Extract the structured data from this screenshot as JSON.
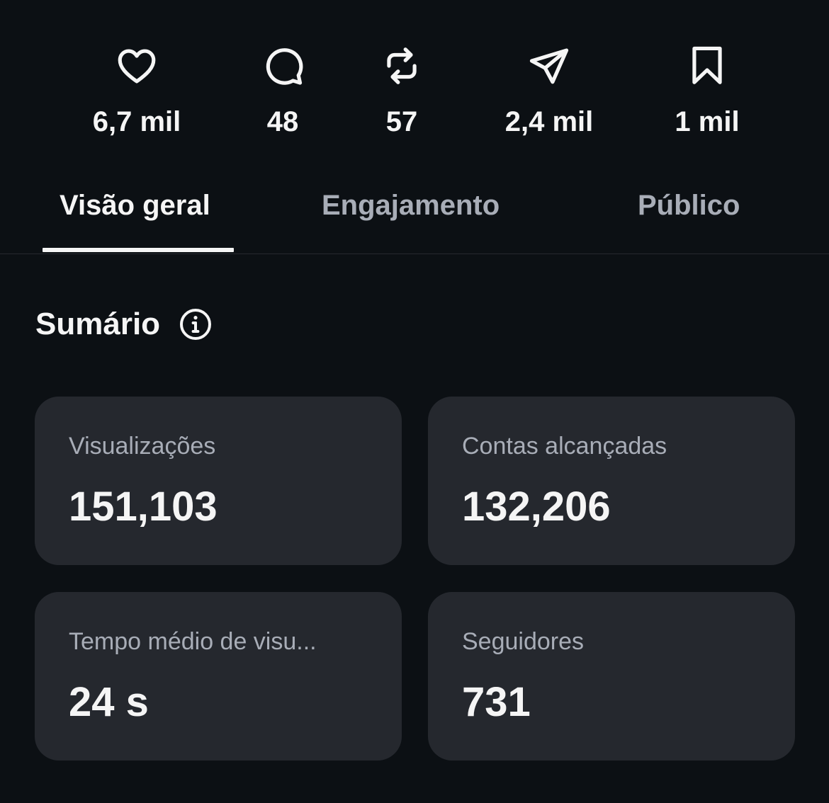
{
  "interactions": [
    {
      "icon": "heart-icon",
      "count": "6,7 mil"
    },
    {
      "icon": "comment-icon",
      "count": "48"
    },
    {
      "icon": "repost-icon",
      "count": "57"
    },
    {
      "icon": "share-icon",
      "count": "2,4 mil"
    },
    {
      "icon": "bookmark-icon",
      "count": "1 mil"
    }
  ],
  "tabs": [
    {
      "label": "Visão geral",
      "active": true
    },
    {
      "label": "Engajamento",
      "active": false
    },
    {
      "label": "Público",
      "active": false
    }
  ],
  "summary": {
    "title": "Sumário",
    "info_icon": "info-icon"
  },
  "metrics": [
    {
      "label": "Visualizações",
      "value": "151,103"
    },
    {
      "label": "Contas alcançadas",
      "value": "132,206"
    },
    {
      "label": "Tempo médio de visu...",
      "value": "24 s"
    },
    {
      "label": "Seguidores",
      "value": "731"
    }
  ],
  "colors": {
    "background": "#0c1014",
    "card": "#25282e",
    "text_primary": "#f5f5f5",
    "text_secondary": "#a8adb7"
  }
}
